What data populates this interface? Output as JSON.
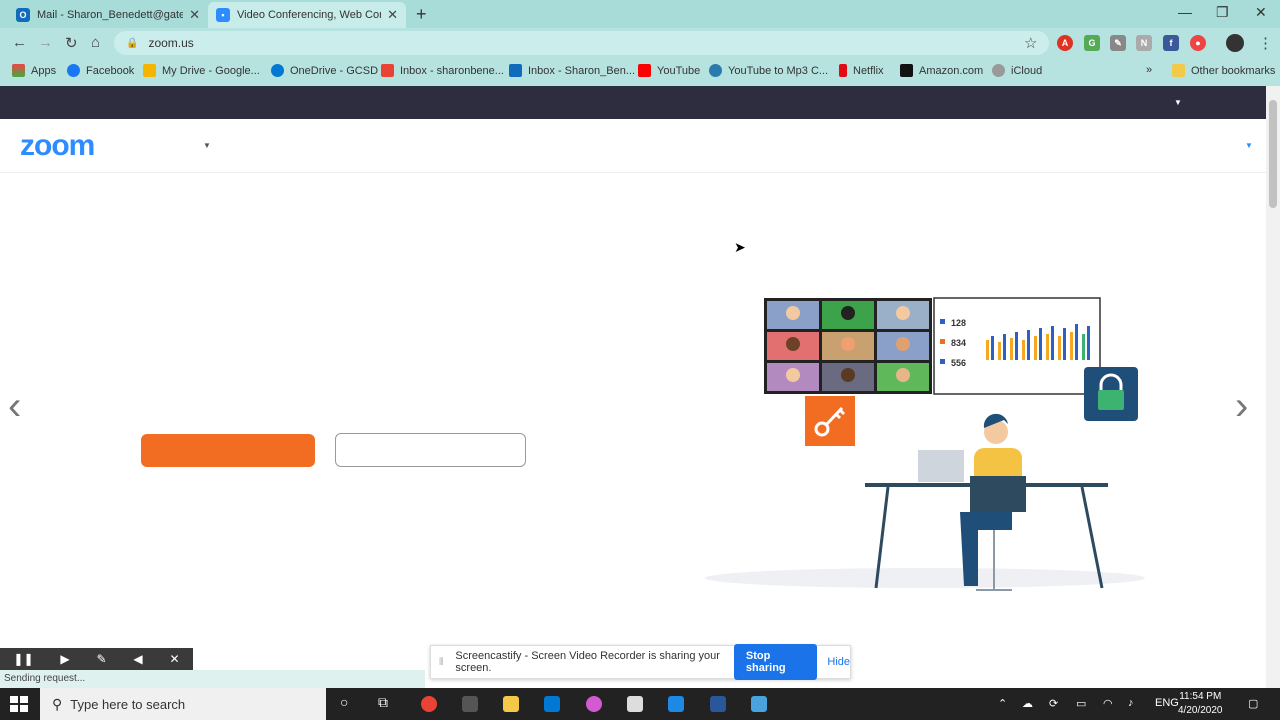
{
  "browser": {
    "tabs": [
      {
        "title": "Mail - Sharon_Benedett@gatesch",
        "favicon_color": "#0f6cbd",
        "favicon_letter": "O"
      },
      {
        "title": "Video Conferencing, Web Confe",
        "favicon_color": "#2d8cff",
        "favicon_letter": "▢"
      }
    ],
    "url": "zoom.us",
    "bookmarks": [
      {
        "label": "Apps",
        "color": "#e44"
      },
      {
        "label": "Facebook",
        "color": "#1877f2"
      },
      {
        "label": "My Drive - Google...",
        "color": "#f4b400"
      },
      {
        "label": "OneDrive - GCSD",
        "color": "#0078d4"
      },
      {
        "label": "Inbox - sharonbene...",
        "color": "#ea4335"
      },
      {
        "label": "Inbox - Sharon_Ben...",
        "color": "#0f6cbd"
      },
      {
        "label": "YouTube",
        "color": "#ff0000"
      },
      {
        "label": "YouTube to Mp3 C...",
        "color": "#2a7ab0"
      },
      {
        "label": "Netflix",
        "color": "#e50914"
      },
      {
        "label": "Amazon.com",
        "color": "#111"
      },
      {
        "label": "iCloud",
        "color": "#999"
      }
    ],
    "more_bookmarks": "»",
    "other_bookmarks": "Other bookmarks"
  },
  "page": {
    "logo": "zoom"
  },
  "illustration": {
    "stats": [
      "128",
      "834",
      "556"
    ]
  },
  "status": "Sending request...",
  "screencastify": {
    "message": "Screencastify - Screen Video Recorder is sharing your screen.",
    "stop_label": "Stop sharing",
    "hide_label": "Hide"
  },
  "taskbar": {
    "search_placeholder": "Type here to search",
    "lang": "ENG",
    "time": "11:54 PM",
    "date": "4/20/2020"
  }
}
